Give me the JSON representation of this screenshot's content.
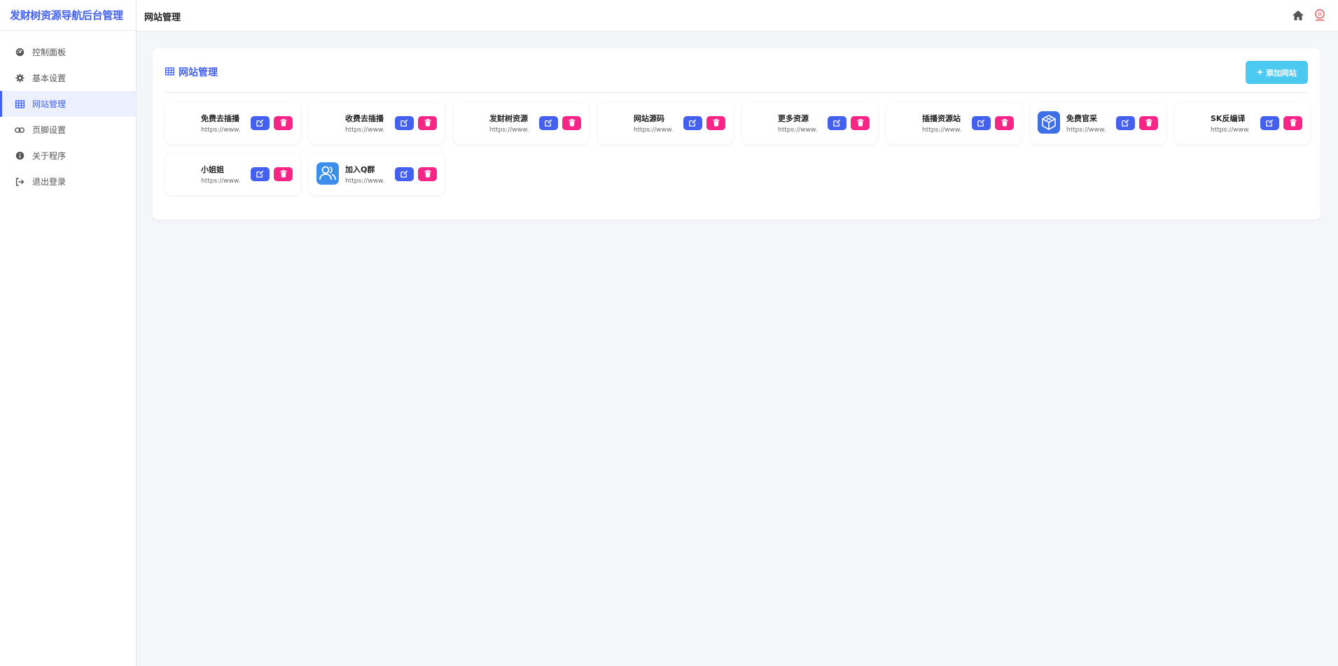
{
  "sidebar": {
    "brand": "发财树资源导航后台管理",
    "items": [
      {
        "label": "控制面板",
        "icon": "dashboard-icon",
        "active": false
      },
      {
        "label": "基本设置",
        "icon": "gear-icon",
        "active": false
      },
      {
        "label": "网站管理",
        "icon": "table-icon",
        "active": true
      },
      {
        "label": "页脚设置",
        "icon": "link-icon",
        "active": false
      },
      {
        "label": "关于程序",
        "icon": "info-icon",
        "active": false
      },
      {
        "label": "退出登录",
        "icon": "logout-icon",
        "active": false
      }
    ]
  },
  "topbar": {
    "title": "网站管理"
  },
  "panel": {
    "title": "网站管理",
    "add_label": "添加网站"
  },
  "sites": [
    {
      "name": "免费去插播",
      "url": "https://www.",
      "icon": "none"
    },
    {
      "name": "收费去插播",
      "url": "https://www.",
      "icon": "none"
    },
    {
      "name": "发财树资源",
      "url": "https://www.",
      "icon": "none"
    },
    {
      "name": "网站源码",
      "url": "https://www.",
      "icon": "none"
    },
    {
      "name": "更多资源",
      "url": "https://www.",
      "icon": "none"
    },
    {
      "name": "插播资源站",
      "url": "https://www.",
      "icon": "none"
    },
    {
      "name": "免费官采",
      "url": "https://www.",
      "icon": "cube-icon"
    },
    {
      "name": "SK反编译",
      "url": "https://www.",
      "icon": "none"
    },
    {
      "name": "小姐姐",
      "url": "https://www.",
      "icon": "none"
    },
    {
      "name": "加入Q群",
      "url": "https://www.",
      "icon": "group-icon"
    }
  ],
  "colors": {
    "primary": "#4361ee",
    "danger": "#f72585",
    "accent": "#4cc9f0"
  }
}
